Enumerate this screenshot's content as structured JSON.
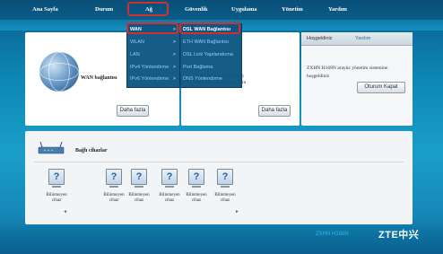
{
  "nav": {
    "items": [
      "Ana Sayfa",
      "Durum",
      "Ağ",
      "Güvenlik",
      "Uygulama",
      "Yönetim",
      "Yardım"
    ]
  },
  "menu_level1": {
    "items": [
      {
        "label": "WAN",
        "arrow": ">"
      },
      {
        "label": "WLAN",
        "arrow": ">"
      },
      {
        "label": "LAN",
        "arrow": ">"
      },
      {
        "label": "IPv4 Yönlendirme",
        "arrow": ">"
      },
      {
        "label": "IPv6 Yönlendirme",
        "arrow": ">"
      }
    ]
  },
  "menu_level2": {
    "items": [
      "DSL WAN Bağlantısı",
      "ETH WAN Bağlantısı",
      "DSL Link Yapılandırma",
      "Port Bağlama",
      "DNS Yönlendirme"
    ]
  },
  "wan_panel": {
    "title": "WAN bağlantısı",
    "more_button": "Daha fazla"
  },
  "wlan_panel": {
    "info_line1": "2.11b+802.11g+802.11n)",
    "info_line2": "Kablosuz RF Modu: Etkin",
    "more_button": "Daha fazla"
  },
  "welcome_panel": {
    "tab_active": "Hoşgeldiniz",
    "tab_other": "Yardım",
    "text": "ZXHN H168N arayüz yönetim sistemine hoşgeldiniz",
    "logout_button": "Oturum Kapat"
  },
  "devices_panel": {
    "title": "Bağlı cihazlar",
    "devices": [
      {
        "label1": "Bilinmeyen",
        "label2": "cihaz"
      },
      {
        "label1": "Bilinmeyen",
        "label2": "cihaz"
      },
      {
        "label1": "Bilinmeyen",
        "label2": "cihaz"
      },
      {
        "label1": "Bilinmeyen",
        "label2": "cihaz"
      },
      {
        "label1": "Bilinmeyen",
        "label2": "cihaz"
      },
      {
        "label1": "Bilinmeyen",
        "label2": "cihaz"
      }
    ],
    "scroll_left": "◄",
    "scroll_right": "►"
  },
  "footer": {
    "text": "ZXHN H168N",
    "logo": "ZTE中兴"
  },
  "colors": {
    "highlight": "#d32f2f",
    "menu_bg": "#0e5482",
    "link": "#8fd0ff"
  }
}
